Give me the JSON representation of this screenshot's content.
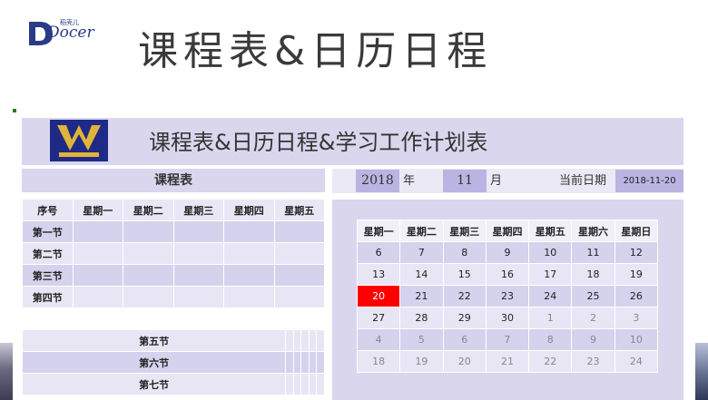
{
  "brand": {
    "logo_text": "Docer",
    "logo_sub": "稻壳儿"
  },
  "page_title": "课程表&日历日程",
  "sheet": {
    "header_title": "课程表&日历日程&学习工作计划表",
    "timetable": {
      "title": "课程表",
      "headers": [
        "序号",
        "星期一",
        "星期二",
        "星期三",
        "星期四",
        "星期五"
      ],
      "rows_top": [
        "第一节",
        "第二节",
        "第三节",
        "第四节"
      ],
      "rows_bottom": [
        "第五节",
        "第六节",
        "第七节"
      ]
    },
    "date_controls": {
      "year": "2018",
      "year_label": "年",
      "month": "11",
      "month_label": "月",
      "current_label": "当前日期",
      "current_value": "2018-11-20"
    },
    "calendar": {
      "weekdays": [
        "星期一",
        "星期二",
        "星期三",
        "星期四",
        "星期五",
        "星期六",
        "星期日"
      ],
      "weeks": [
        [
          "6",
          "7",
          "8",
          "9",
          "10",
          "11",
          "12"
        ],
        [
          "13",
          "14",
          "15",
          "16",
          "17",
          "18",
          "19"
        ],
        [
          "20",
          "21",
          "22",
          "23",
          "24",
          "25",
          "26"
        ],
        [
          "27",
          "28",
          "29",
          "30",
          "1",
          "2",
          "3"
        ],
        [
          "4",
          "5",
          "6",
          "7",
          "8",
          "9",
          "10"
        ],
        [
          "18",
          "19",
          "20",
          "21",
          "22",
          "23",
          "24"
        ]
      ],
      "highlight_color": "#ff0000"
    }
  }
}
